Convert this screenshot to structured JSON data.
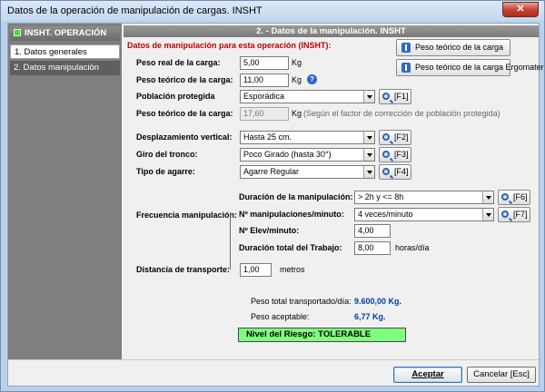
{
  "window": {
    "title": "Datos de la operación de manipulación de cargas. INSHT",
    "close_glyph": "✕"
  },
  "sidebar": {
    "header": "INSHT. OPERACIÓN",
    "items": [
      {
        "label": "1. Datos generales"
      },
      {
        "label": "2. Datos manipulación"
      }
    ]
  },
  "panel": {
    "title": "2. - Datos de la manipulación. INSHT",
    "section_title": "Datos de manipulación para esta operación (INSHT):",
    "btn_peso_teorico": "Peso teórico de la carga",
    "btn_peso_ergomater": "Peso teórico de la carga Ergomater",
    "peso_real": {
      "label": "Peso real de la carga:",
      "value": "5,00",
      "unit": "Kg"
    },
    "peso_teorico": {
      "label": "Peso teórico de la carga:",
      "value": "11,00",
      "unit": "Kg",
      "help": "?"
    },
    "poblacion": {
      "label": "Población protegida",
      "value": "Esporádica",
      "key": "[F1]"
    },
    "peso_teorico2": {
      "label": "Peso teórico de la carga:",
      "value": "17,60",
      "unit": "Kg",
      "note": "(Según el factor de corrección de población protegida)"
    },
    "desplazamiento": {
      "label": "Desplazamiento vertical:",
      "value": "Hasta 25 cm.",
      "key": "[F2]"
    },
    "giro": {
      "label": "Giro del tronco:",
      "value": "Poco Girado (hasta 30°)",
      "key": "[F3]"
    },
    "agarre": {
      "label": "Tipo de agarre:",
      "value": "Agarre Regular",
      "key": "[F4]"
    },
    "frecuencia": {
      "label": "Frecuencia manipulación:",
      "duracion": {
        "label": "Duración de la manipulación:",
        "value": "> 2h y <= 8h",
        "key": "[F6]"
      },
      "manipulaciones": {
        "label": "Nº manipulaciones/minuto:",
        "value": "4 veces/minuto",
        "key": "[F7]"
      },
      "elev": {
        "label": "Nº Elev/minuto:",
        "value": "4,00"
      },
      "duracion_total": {
        "label": "Duración total del Trabajo:",
        "value": "8,00",
        "unit": "horas/día"
      }
    },
    "distancia": {
      "label": "Distancia de transporte:",
      "value": "1,00",
      "unit": "metros"
    },
    "results": {
      "peso_total_label": "Peso total transportado/día:",
      "peso_total_value": "9.600,00 Kg.",
      "peso_aceptable_label": "Peso aceptable:",
      "peso_aceptable_value": "6,77 Kg."
    },
    "risk_text": "Nivel del Riesgo:  TOLERABLE"
  },
  "footer": {
    "accept": "Aceptar",
    "cancel": "Cancelar [Esc]"
  },
  "colors": {
    "risk_bg": "#7fff7f",
    "section_title": "#c00000",
    "result_value": "#003ea0"
  }
}
